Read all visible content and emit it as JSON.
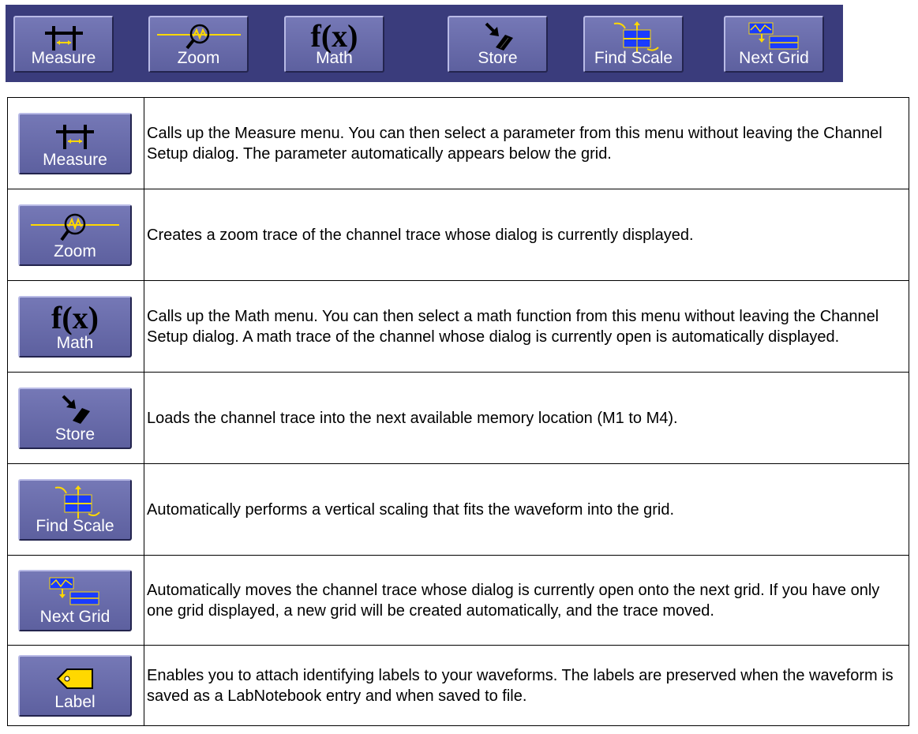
{
  "toolbar": {
    "buttons": [
      {
        "label": "Measure",
        "icon": "measure-icon"
      },
      {
        "label": "Zoom",
        "icon": "zoom-icon"
      },
      {
        "label": "Math",
        "glyph": "f(x)",
        "icon": "fx-icon"
      },
      {
        "label": "Store",
        "icon": "store-icon"
      },
      {
        "label": "Find Scale",
        "icon": "find-scale-icon"
      },
      {
        "label": "Next Grid",
        "icon": "next-grid-icon"
      }
    ]
  },
  "rows": [
    {
      "button": "Measure",
      "description": "Calls up the Measure menu. You can then select a parameter from this menu without leaving the Channel Setup dialog. The parameter automatically appears below the grid."
    },
    {
      "button": "Zoom",
      "description": "Creates a zoom trace of the channel trace whose dialog is currently displayed."
    },
    {
      "button": "Math",
      "glyph": "f(x)",
      "description": "Calls up the Math menu. You can then select a math function from this menu without leaving the Channel Setup dialog. A math trace of the channel whose dialog is currently open is automatically displayed."
    },
    {
      "button": "Store",
      "description": "Loads the channel trace into the next available memory location (M1 to M4)."
    },
    {
      "button": "Find Scale",
      "description": "Automatically performs a vertical scaling that fits the waveform into the grid."
    },
    {
      "button": "Next Grid",
      "description": "Automatically moves the channel trace whose dialog is currently open onto the next grid. If you have only one grid displayed, a new grid will be created automatically, and the trace moved."
    },
    {
      "button": "Label",
      "description": "Enables you to attach identifying labels to your waveforms. The labels are preserved when the waveform is saved as a LabNotebook entry and when saved to file."
    }
  ],
  "colors": {
    "toolbar_bg": "#3a3c7c",
    "button_face": "#6a6daa",
    "icon_yellow": "#ffd800",
    "icon_blue": "#1a3cff"
  }
}
